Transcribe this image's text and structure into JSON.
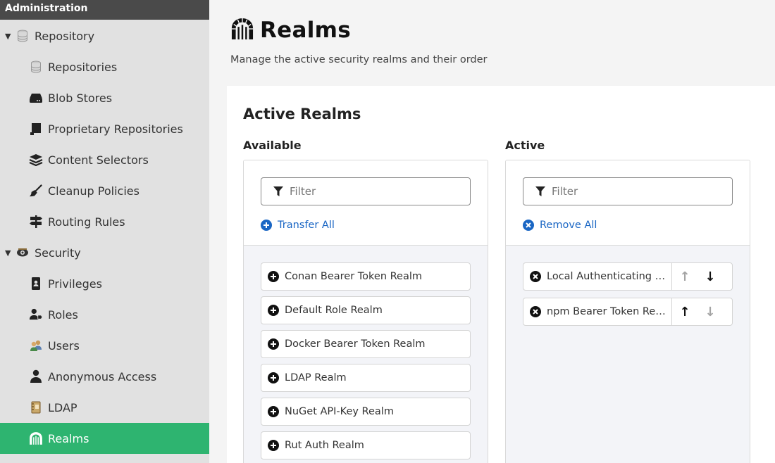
{
  "sidebar": {
    "header": "Administration",
    "items": [
      {
        "label": "Repository",
        "icon": "database-icon"
      },
      {
        "label": "Repositories",
        "icon": "database-icon"
      },
      {
        "label": "Blob Stores",
        "icon": "hard-drive-icon"
      },
      {
        "label": "Proprietary Repositories",
        "icon": "flag-icon"
      },
      {
        "label": "Content Selectors",
        "icon": "layers-icon"
      },
      {
        "label": "Cleanup Policies",
        "icon": "broom-icon"
      },
      {
        "label": "Routing Rules",
        "icon": "signpost-icon"
      },
      {
        "label": "Security",
        "icon": "eye-icon"
      },
      {
        "label": "Privileges",
        "icon": "id-badge-icon"
      },
      {
        "label": "Roles",
        "icon": "user-tag-icon"
      },
      {
        "label": "Users",
        "icon": "users-icon"
      },
      {
        "label": "Anonymous Access",
        "icon": "user-icon"
      },
      {
        "label": "LDAP",
        "icon": "address-book-icon"
      },
      {
        "label": "Realms",
        "icon": "dungeon-icon"
      }
    ]
  },
  "page": {
    "title": "Realms",
    "subtitle": "Manage the active security realms and their order",
    "card_title": "Active Realms"
  },
  "available": {
    "title": "Available",
    "filter_placeholder": "Filter",
    "action": "Transfer All",
    "items": [
      "Conan Bearer Token Realm",
      "Default Role Realm",
      "Docker Bearer Token Realm",
      "LDAP Realm",
      "NuGet API-Key Realm",
      "Rut Auth Realm"
    ]
  },
  "active": {
    "title": "Active",
    "filter_placeholder": "Filter",
    "action": "Remove All",
    "items": [
      "Local Authenticating Realm",
      "npm Bearer Token Realm"
    ]
  },
  "colors": {
    "accent": "#2eb470",
    "link": "#1a66c4",
    "sidebar_bg": "#e1e1e1",
    "sidebar_header_bg": "#4a4a4a"
  }
}
